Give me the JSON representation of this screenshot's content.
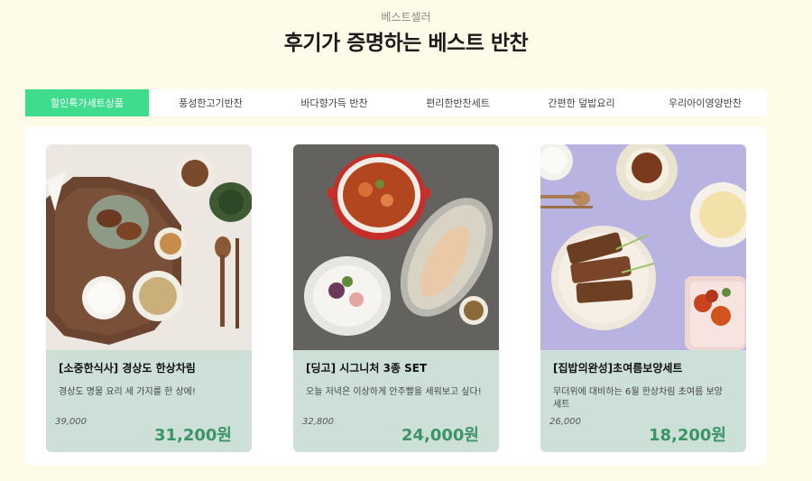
{
  "section": {
    "eyebrow": "베스트셀러",
    "title": "후기가 증명하는 베스트 반찬"
  },
  "tabs": [
    {
      "label": "할인특가세트상품",
      "active": true
    },
    {
      "label": "풍성한고기반찬",
      "active": false
    },
    {
      "label": "바다향가득 반찬",
      "active": false
    },
    {
      "label": "편리한반찬세트",
      "active": false
    },
    {
      "label": "간편한 덮밥요리",
      "active": false
    },
    {
      "label": "우리아이영양반찬",
      "active": false
    }
  ],
  "products": [
    {
      "name": "[소중한식사] 경상도 한상차림",
      "description": "경상도 명물 요리 세 가지를 한 상에!",
      "original_price": "39,000",
      "price": "31,200원",
      "image": "korean-meal-wooden-tray-photo"
    },
    {
      "name": "[딩고] 시그니처 3종 SET",
      "description": "오늘 저녁은 이상하게 안주빨을 세워보고 싶다!",
      "original_price": "32,800",
      "price": "24,000원",
      "image": "stew-and-sliced-meat-photo"
    },
    {
      "name": "[집밥의완성]초여름보양세트",
      "description": "무더위에 대비하는 6월 한상차림 초여름 보양세트",
      "original_price": "26,000",
      "price": "18,200원",
      "image": "grilled-eel-on-purple-photo"
    }
  ],
  "colors": {
    "page_background": "#fefce9",
    "active_tab": "#3fdc8e",
    "card_info_background": "#cde0d7",
    "price_text": "#3c9466"
  }
}
